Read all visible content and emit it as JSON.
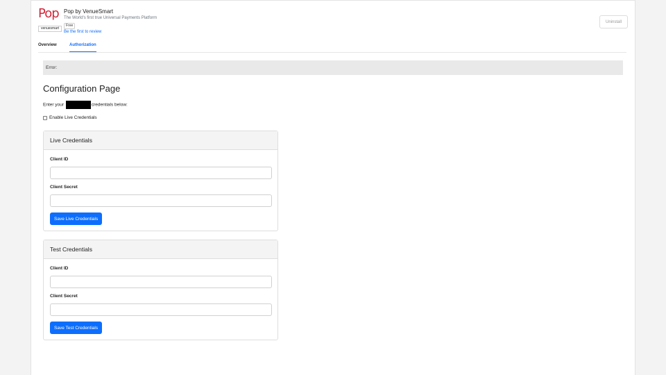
{
  "app": {
    "logo_text": "Pop",
    "logo_brand": "venuesmart",
    "name": "Pop by VenueSmart",
    "subtitle": "The World's first true Universal Payments Platform",
    "price_badge": "Free",
    "review_link": "Be the first to review",
    "uninstall_label": "Uninstall"
  },
  "tabs": [
    {
      "label": "Overview",
      "active": false
    },
    {
      "label": "Authorization",
      "active": true
    }
  ],
  "error": {
    "text": "Error:"
  },
  "config": {
    "title": "Configuration Page",
    "enter_prefix": "Enter your",
    "enter_suffix": "credentials below:",
    "enable_live_label": "Enable Live Credentials",
    "enable_live_checked": false
  },
  "live": {
    "header": "Live Credentials",
    "client_id_label": "Client ID",
    "client_id_value": "",
    "client_secret_label": "Client Secret",
    "client_secret_value": "",
    "save_label": "Save Live Credentials"
  },
  "test": {
    "header": "Test Credentials",
    "client_id_label": "Client ID",
    "client_id_value": "",
    "client_secret_label": "Client Secret",
    "client_secret_value": "",
    "save_label": "Save Test Credentials"
  },
  "colors": {
    "accent": "#0d6efd",
    "logo_red": "#d1263a",
    "error_bg": "#e9e9e9"
  }
}
